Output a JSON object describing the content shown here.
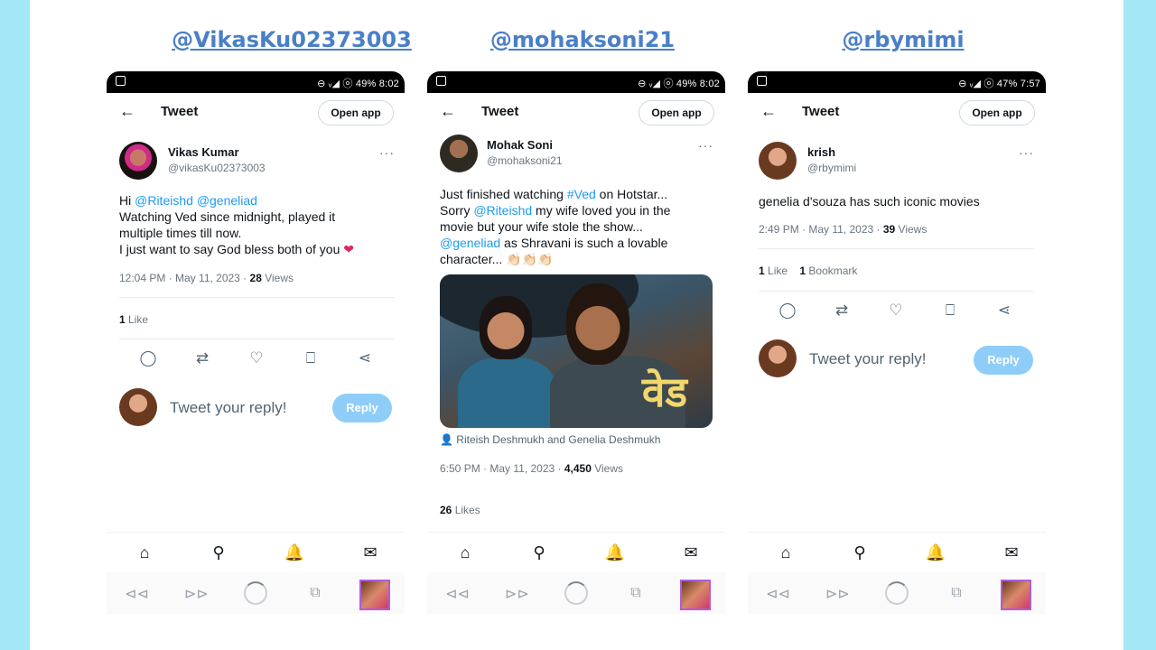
{
  "columns": [
    {
      "title": "@VikasKu02373003",
      "status": "⊖ ᵥ◢ ⓞ 49% 8:02",
      "topbar": {
        "title": "Tweet",
        "open_app": "Open app"
      },
      "user": {
        "name": "Vikas Kumar",
        "handle": "@vikasKu02373003"
      },
      "text_lines": [
        "@Riteishd @geneliad",
        "Watching Ved since midnight, played it",
        "multiple times till now.",
        "I just want to say God bless both of you"
      ],
      "mentions": [
        "@Riteishd",
        "@geneliad"
      ],
      "heart": "❤",
      "timestamp": "12:04 PM · May 11, 2023 · ",
      "views_count": "28",
      "views_label": " Views",
      "likes_count": "1",
      "likes_label": " Like",
      "reply_placeholder": "Tweet your reply!",
      "reply_button": "Reply"
    },
    {
      "title": "@mohaksoni21",
      "status": "⊖ ᵥ◢ ⓞ 49% 8:02",
      "topbar": {
        "title": "Tweet",
        "open_app": "Open app"
      },
      "user": {
        "name": "Mohak Soni",
        "handle": "@mohaksoni21"
      },
      "text_lines": [
        "Just finished watching #Ved on Hotstar...",
        "Sorry @Riteishd my wife loved you in the",
        "movie but your wife stole the show...",
        "@geneliad as Shravani is such a lovable",
        "character... 👏🏻👏🏻👏🏻"
      ],
      "image_logo": "वेड",
      "credit": "Riteish Deshmukh and Genelia Deshmukh",
      "timestamp": "6:50 PM · May 11, 2023 · ",
      "views_count": "4,450",
      "views_label": " Views",
      "likes_count": "26",
      "likes_label": " Likes"
    },
    {
      "title": "@rbymimi",
      "status": "⊖ ᵥ◢ ⓞ 47% 7:57",
      "topbar": {
        "title": "Tweet",
        "open_app": "Open app"
      },
      "user": {
        "name": "krish",
        "handle": "@rbymimi"
      },
      "text_lines": [
        "genelia d'souza has such iconic movies"
      ],
      "timestamp": "2:49 PM · May 11, 2023 · ",
      "views_count": "39",
      "views_label": " Views",
      "likes_count": "1",
      "likes_label": " Like",
      "bookmarks_count": "1",
      "bookmarks_label": " Bookmark",
      "reply_placeholder": "Tweet your reply!",
      "reply_button": "Reply"
    }
  ],
  "icons": {
    "back": "←",
    "more": "···",
    "reply": "◯",
    "retweet": "⇄",
    "like": "♡",
    "bookmark": "⎕",
    "share": "⋖",
    "home": "⌂",
    "search": "⚲",
    "bell": "🔔",
    "mail": "✉",
    "browser_back": "⊲⊲",
    "browser_forward": "⊳⊳",
    "tabs": "⧉",
    "person": "👤"
  }
}
